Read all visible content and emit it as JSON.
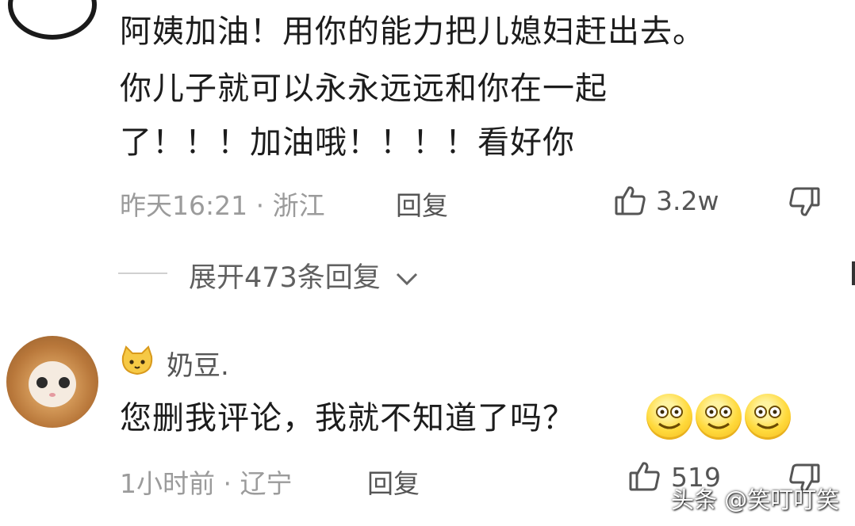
{
  "comment1": {
    "text_lines": [
      "阿姨加油！用你的能力把儿媳妇赶出去。",
      "你儿子就可以永永远远和你在一起",
      "了！！！加油哦！！！！看好你"
    ],
    "meta": "昨天16:21 · 浙江",
    "reply_label": "回复",
    "like_count": "3.2w"
  },
  "expand_replies": "展开473条回复",
  "comment2": {
    "username": "奶豆.",
    "text": "您删我评论，我就不知道了吗？",
    "emoji_count": 3,
    "meta": "1小时前 · 辽宁",
    "reply_label": "回复",
    "like_count": "519"
  },
  "watermark": "头条 @笑叮叮笑",
  "icons": [
    "thumbs-up-icon",
    "thumbs-down-icon",
    "chevron-down-icon",
    "cat-icon",
    "smiley-emoji-icon"
  ]
}
